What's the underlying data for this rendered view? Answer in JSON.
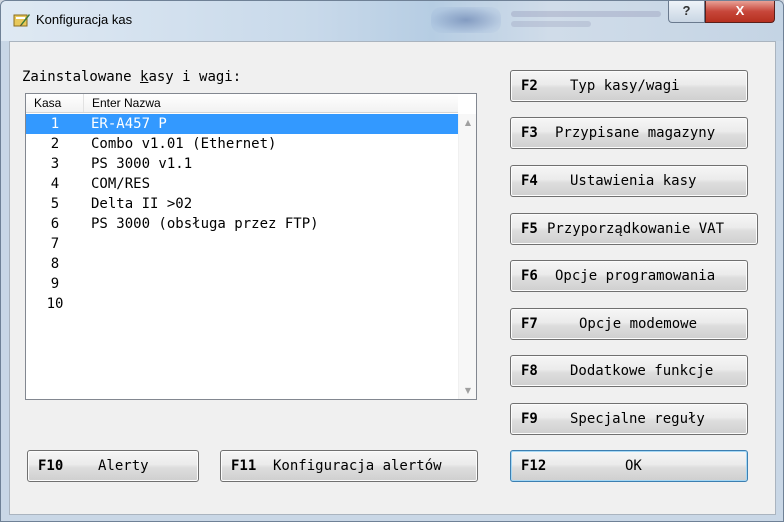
{
  "window": {
    "title": "Konfiguracja kas",
    "help_glyph": "?",
    "close_glyph": "X"
  },
  "list": {
    "caption_pre": "Zainstalowane ",
    "caption_u": "k",
    "caption_post": "asy i wagi:",
    "columns": [
      "Kasa",
      "Enter Nazwa"
    ],
    "rows": [
      {
        "num": "1",
        "name": "ER-A457 P",
        "selected": true
      },
      {
        "num": "2",
        "name": "Combo v1.01 (Ethernet)"
      },
      {
        "num": "3",
        "name": "PS 3000 v1.1"
      },
      {
        "num": "4",
        "name": "COM/RES"
      },
      {
        "num": "5",
        "name": "Delta II >02"
      },
      {
        "num": "6",
        "name": "PS 3000 (obsługa przez FTP)"
      },
      {
        "num": "7",
        "name": ""
      },
      {
        "num": "8",
        "name": ""
      },
      {
        "num": "9",
        "name": ""
      },
      {
        "num": "10",
        "name": ""
      }
    ],
    "scroll_up": "▲",
    "scroll_down": "▼"
  },
  "buttons": {
    "f2": {
      "key": "F2",
      "label": "Typ kasy/wagi"
    },
    "f3": {
      "key": "F3",
      "label": "Przypisane magazyny"
    },
    "f4": {
      "key": "F4",
      "label": "Ustawienia kasy"
    },
    "f5": {
      "key": "F5",
      "label": "Przyporządkowanie VAT"
    },
    "f6": {
      "key": "F6",
      "label": "Opcje programowania"
    },
    "f7": {
      "key": "F7",
      "label": "Opcje modemowe"
    },
    "f8": {
      "key": "F8",
      "label": "Dodatkowe funkcje"
    },
    "f9": {
      "key": "F9",
      "label": "Specjalne reguły"
    },
    "f10": {
      "key": "F10",
      "label": "Alerty"
    },
    "f11": {
      "key": "F11",
      "label": "Konfiguracja alertów"
    },
    "f12": {
      "key": "F12",
      "label": "OK"
    }
  },
  "colors": {
    "selection": "#3399ff",
    "close_button": "#c7463a"
  }
}
